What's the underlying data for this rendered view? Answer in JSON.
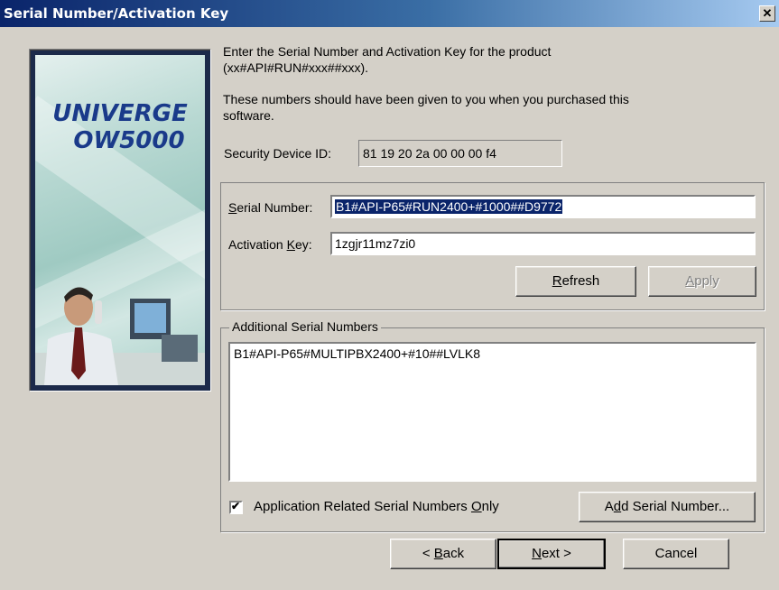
{
  "window": {
    "title": "Serial Number/Activation Key",
    "close_glyph": "✕"
  },
  "banner": {
    "product_line1": "UNIVERGE",
    "product_line2": "OW5000"
  },
  "intro": {
    "line1": "Enter the Serial Number and Activation Key for the product",
    "line2": "(xx#API#RUN#xxx##xxx).",
    "line3": "These numbers should have been given to you when you purchased this",
    "line4": "software."
  },
  "security": {
    "label": "Security Device ID:",
    "value": "81 19 20 2a 00 00 00 f4"
  },
  "serial": {
    "label_prefix": "S",
    "label_rest": "erial Number:",
    "value": "B1#API-P65#RUN2400+#1000##D9772"
  },
  "activation": {
    "label_prefix": "Activation ",
    "label_access": "K",
    "label_rest": "ey:",
    "value": "1zgjr11mz7zi0"
  },
  "buttons": {
    "refresh_access": "R",
    "refresh_rest": "efresh",
    "apply_access": "A",
    "apply_rest": "pply",
    "add_prefix": "A",
    "add_access": "d",
    "add_rest": "d Serial Number...",
    "back_prefix": "< ",
    "back_access": "B",
    "back_rest": "ack",
    "next_access": "N",
    "next_rest": "ext >",
    "cancel": "Cancel"
  },
  "additional": {
    "group_label": "Additional Serial Numbers",
    "items": [
      "B1#API-P65#MULTIPBX2400+#10##LVLK8"
    ]
  },
  "checkbox": {
    "checked": true,
    "check_glyph": "✔",
    "label_prefix": "Application Related Serial Numbers ",
    "label_access": "O",
    "label_rest": "nly"
  }
}
